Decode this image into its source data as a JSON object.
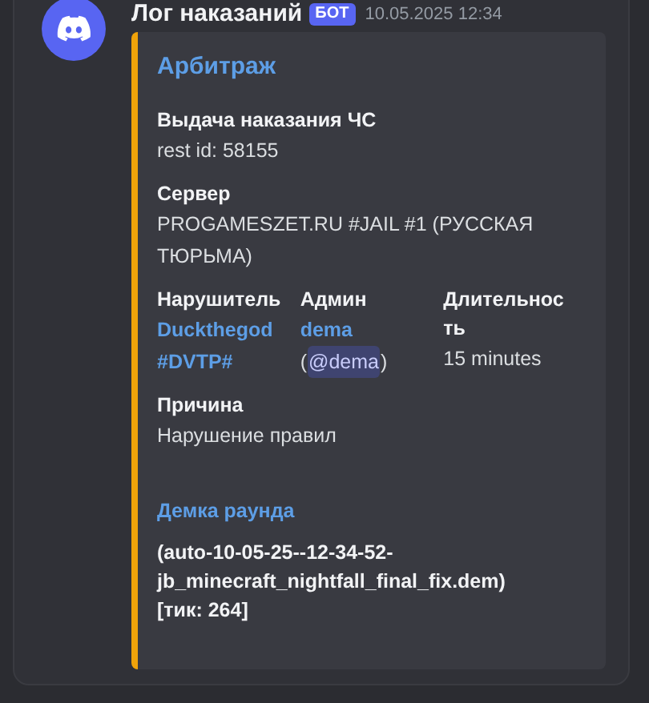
{
  "message": {
    "author": "Лог наказаний",
    "badge": "БОТ",
    "timestamp": "10.05.2025 12:34"
  },
  "embed": {
    "title": "Арбитраж",
    "fields": [
      {
        "kind": "text",
        "inline": false,
        "name": "Выдача наказания ЧС",
        "value": "rest id: 58155"
      },
      {
        "kind": "text",
        "inline": false,
        "name": "Сервер",
        "value": "PROGAMESZET.RU #JAIL #1 (РУССКАЯ ТЮРЬМА)"
      },
      {
        "kind": "link",
        "inline": true,
        "name": "Нарушитель",
        "value": "Duckthegod #DVTP#"
      },
      {
        "kind": "mention",
        "inline": true,
        "name": "Админ",
        "value": "dema",
        "open": "(",
        "mention": "@dema",
        "close": ")"
      },
      {
        "kind": "text",
        "inline": true,
        "name": "Длительность",
        "value": "15 minutes"
      },
      {
        "kind": "text",
        "inline": false,
        "name": "Причина",
        "value": "Нарушение правил"
      },
      {
        "kind": "demo",
        "inline": false,
        "name": "Демка раунда",
        "value": "(auto-10-05-25--12-34-52-jb_minecraft_nightfall_final_fix.dem)\n[тик: 264]"
      }
    ]
  }
}
